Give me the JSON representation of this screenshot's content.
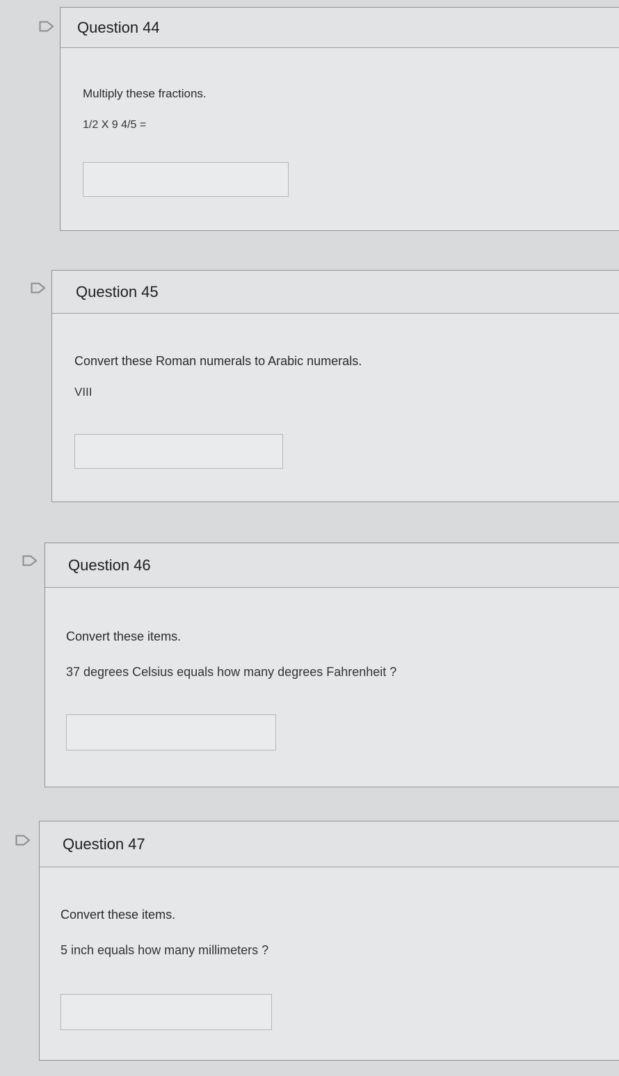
{
  "questions": [
    {
      "title": "Question 44",
      "prompt": "Multiply these fractions.",
      "detail": "1/2 X 9 4/5 =",
      "answer_value": ""
    },
    {
      "title": "Question 45",
      "prompt": "Convert these Roman numerals to Arabic numerals.",
      "detail": "VIII",
      "answer_value": ""
    },
    {
      "title": "Question 46",
      "prompt": "Convert these items.",
      "detail": "37 degrees Celsius equals how many degrees Fahrenheit ?",
      "answer_value": ""
    },
    {
      "title": "Question 47",
      "prompt": "Convert these items.",
      "detail": "5 inch equals how many millimeters ?",
      "answer_value": ""
    }
  ],
  "icons": {
    "flag": "flag-outline-icon"
  },
  "colors": {
    "page_background": "#d9dadb",
    "card_background": "#e6e7e8",
    "card_border": "#8f9193"
  }
}
